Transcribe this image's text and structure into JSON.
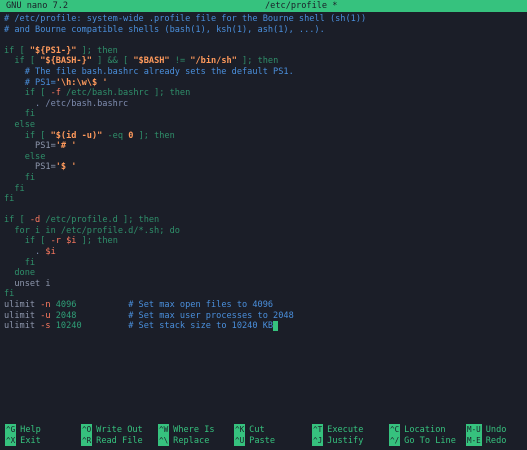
{
  "title_bar": {
    "app": "GNU nano 7.2",
    "file": "/etc/profile *"
  },
  "lines": [
    [
      {
        "t": "# /etc/profile: system-wide .profile file for the Bourne shell (sh(1))",
        "c": "cm"
      }
    ],
    [
      {
        "t": "# and Bourne compatible shells (bash(1), ksh(1), ash(1), ...).",
        "c": "cm"
      }
    ],
    [],
    [
      {
        "t": "if [ ",
        "c": "kw"
      },
      {
        "t": "\"${PS1-}\"",
        "c": "strb"
      },
      {
        "t": " ]; then",
        "c": "kw"
      }
    ],
    [
      {
        "t": "  if [ ",
        "c": "kw"
      },
      {
        "t": "\"${BASH-}\"",
        "c": "strb"
      },
      {
        "t": " ] && [ ",
        "c": "kw"
      },
      {
        "t": "\"$BASH\"",
        "c": "strb"
      },
      {
        "t": " != ",
        "c": "kw"
      },
      {
        "t": "\"/bin/sh\"",
        "c": "strb"
      },
      {
        "t": " ]; then",
        "c": "kw"
      }
    ],
    [
      {
        "t": "    # The file bash.bashrc already sets the default PS1.",
        "c": "cm"
      }
    ],
    [
      {
        "t": "    # PS1=",
        "c": "cm"
      },
      {
        "t": "'\\h:\\w\\$ '",
        "c": "strb"
      }
    ],
    [
      {
        "t": "    if [ ",
        "c": "kw"
      },
      {
        "t": "-f",
        "c": "var"
      },
      {
        "t": " /etc/bash.bashrc ]; then",
        "c": "kw"
      }
    ],
    [
      {
        "t": "      . /etc/bash.bashrc",
        "c": "cmd"
      }
    ],
    [
      {
        "t": "    fi",
        "c": "kw"
      }
    ],
    [
      {
        "t": "  else",
        "c": "kw"
      }
    ],
    [
      {
        "t": "    if [ ",
        "c": "kw"
      },
      {
        "t": "\"$(id -u)\"",
        "c": "strb"
      },
      {
        "t": " -eq ",
        "c": "kw"
      },
      {
        "t": "0",
        "c": "strb"
      },
      {
        "t": " ]; then",
        "c": "kw"
      }
    ],
    [
      {
        "t": "      PS1=",
        "c": "plain"
      },
      {
        "t": "'# '",
        "c": "strb"
      }
    ],
    [
      {
        "t": "    else",
        "c": "kw"
      }
    ],
    [
      {
        "t": "      PS1=",
        "c": "plain"
      },
      {
        "t": "'$ '",
        "c": "strb"
      }
    ],
    [
      {
        "t": "    fi",
        "c": "kw"
      }
    ],
    [
      {
        "t": "  fi",
        "c": "kw"
      }
    ],
    [
      {
        "t": "fi",
        "c": "kw"
      }
    ],
    [],
    [
      {
        "t": "if [ ",
        "c": "kw"
      },
      {
        "t": "-d",
        "c": "var"
      },
      {
        "t": " /etc/profile.d ]; then",
        "c": "kw"
      }
    ],
    [
      {
        "t": "  for i in /etc/profile.d/*.sh; do",
        "c": "kw"
      }
    ],
    [
      {
        "t": "    if [ ",
        "c": "kw"
      },
      {
        "t": "-r",
        "c": "var"
      },
      {
        "t": " ",
        "c": "kw"
      },
      {
        "t": "$i",
        "c": "var"
      },
      {
        "t": " ]; then",
        "c": "kw"
      }
    ],
    [
      {
        "t": "      . ",
        "c": "cmd"
      },
      {
        "t": "$i",
        "c": "var"
      }
    ],
    [
      {
        "t": "    fi",
        "c": "kw"
      }
    ],
    [
      {
        "t": "  done",
        "c": "kw"
      }
    ],
    [
      {
        "t": "  unset i",
        "c": "plain"
      }
    ],
    [
      {
        "t": "fi",
        "c": "kw"
      }
    ],
    [
      {
        "t": "ulimit ",
        "c": "plain"
      },
      {
        "t": "-n",
        "c": "var"
      },
      {
        "t": " 4096          ",
        "c": "num"
      },
      {
        "t": "# Set max open files to 4096",
        "c": "cm"
      }
    ],
    [
      {
        "t": "ulimit ",
        "c": "plain"
      },
      {
        "t": "-u",
        "c": "var"
      },
      {
        "t": " 2048          ",
        "c": "num"
      },
      {
        "t": "# Set max user processes to 2048",
        "c": "cm"
      }
    ],
    [
      {
        "t": "ulimit ",
        "c": "plain"
      },
      {
        "t": "-s",
        "c": "var"
      },
      {
        "t": " 10240         ",
        "c": "num"
      },
      {
        "t": "# Set stack size to 10240 KB",
        "c": "cm"
      },
      {
        "cursor": true
      }
    ]
  ],
  "shortcuts": [
    {
      "key": "^G",
      "label": "Help",
      "name": "shortcut-help",
      "col": 0,
      "row": 0
    },
    {
      "key": "^X",
      "label": "Exit",
      "name": "shortcut-exit",
      "col": 0,
      "row": 1
    },
    {
      "key": "^O",
      "label": "Write Out",
      "name": "shortcut-write-out",
      "col": 1,
      "row": 0
    },
    {
      "key": "^R",
      "label": "Read File",
      "name": "shortcut-read-file",
      "col": 1,
      "row": 1
    },
    {
      "key": "^W",
      "label": "Where Is",
      "name": "shortcut-where-is",
      "col": 2,
      "row": 0
    },
    {
      "key": "^\\",
      "label": "Replace",
      "name": "shortcut-replace",
      "col": 2,
      "row": 1
    },
    {
      "key": "^K",
      "label": "Cut",
      "name": "shortcut-cut",
      "col": 3,
      "row": 0
    },
    {
      "key": "^U",
      "label": "Paste",
      "name": "shortcut-paste",
      "col": 3,
      "row": 1
    },
    {
      "key": "^T",
      "label": "Execute",
      "name": "shortcut-execute",
      "col": 4,
      "row": 0
    },
    {
      "key": "^J",
      "label": "Justify",
      "name": "shortcut-justify",
      "col": 4,
      "row": 1
    },
    {
      "key": "^C",
      "label": "Location",
      "name": "shortcut-location",
      "col": 5,
      "row": 0
    },
    {
      "key": "^/",
      "label": "Go To Line",
      "name": "shortcut-go-to-line",
      "col": 5,
      "row": 1
    },
    {
      "key": "M-U",
      "label": "Undo",
      "name": "shortcut-undo",
      "col": 6,
      "row": 0
    },
    {
      "key": "M-E",
      "label": "Redo",
      "name": "shortcut-redo",
      "col": 6,
      "row": 1
    }
  ],
  "colors": {
    "background": "#1b1e28",
    "accent": "#36c27e",
    "comment": "#4a8fdc",
    "string": "#ff9a5c",
    "variable": "#ff7b61"
  }
}
